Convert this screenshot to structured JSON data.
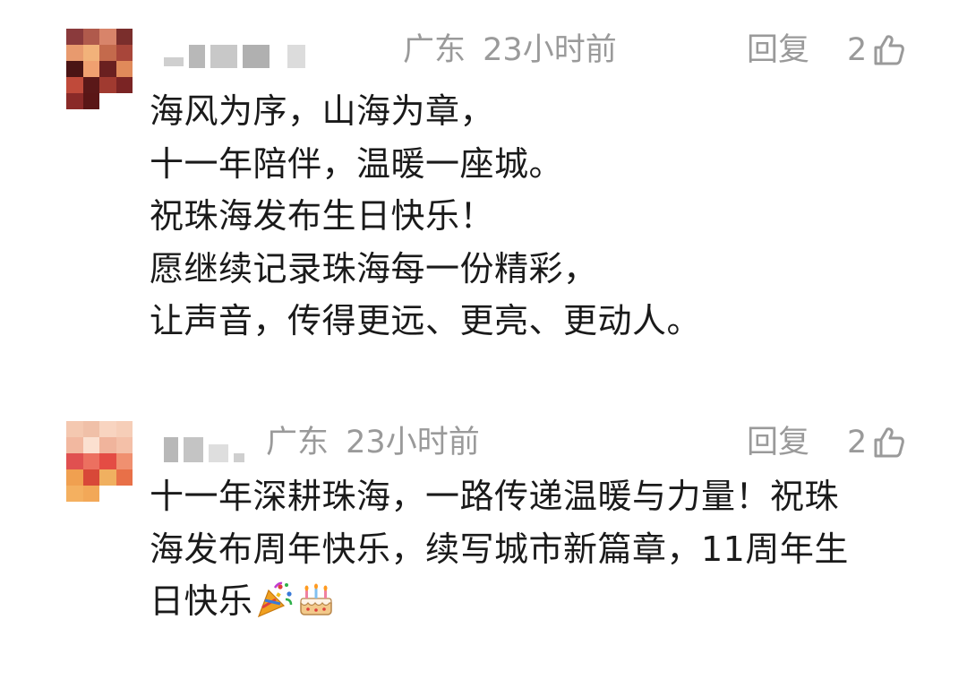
{
  "comments": [
    {
      "location": "广东",
      "time": "23小时前",
      "reply_label": "回复",
      "likes": "2",
      "lines": [
        "海风为序，山海为章，",
        "十一年陪伴，温暖一座城。",
        "祝珠海发布生日快乐！",
        "愿继续记录珠海每一份精彩，",
        "让声音，传得更远、更亮、更动人。"
      ]
    },
    {
      "location": "广东",
      "time": "23小时前",
      "reply_label": "回复",
      "likes": "2",
      "lines": [
        "十一年深耕珠海，一路传递温暖与力量！祝珠",
        "海发布周年快乐，续写城市新篇章，11周年生",
        "日快乐"
      ],
      "emojis": [
        "party-popper-icon",
        "birthday-cake-icon"
      ]
    }
  ],
  "colors": {
    "meta_gray": "#9a9a9a",
    "text": "#1a1a1a",
    "background": "#ffffff"
  }
}
